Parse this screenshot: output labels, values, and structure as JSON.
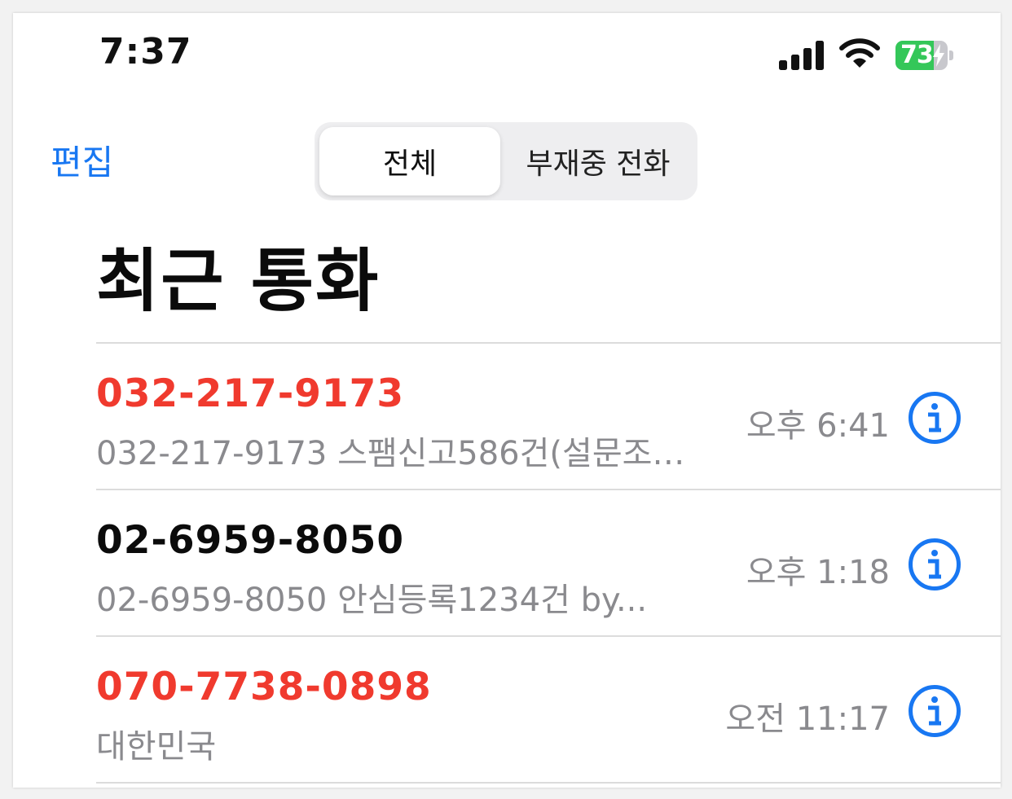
{
  "status_bar": {
    "time": "7:37",
    "battery_level": "73",
    "battery_fraction": 0.73
  },
  "nav": {
    "edit_label": "편집",
    "segments": [
      {
        "label": "전체",
        "selected": true
      },
      {
        "label": "부재중 전화",
        "selected": false
      }
    ]
  },
  "page_title": "최근 통화",
  "calls": [
    {
      "number": "032-217-9173",
      "detail": "032-217-9173 스팸신고586건(설문조…",
      "time": "오후 6:41",
      "missed": true
    },
    {
      "number": "02-6959-8050",
      "detail": "02-6959-8050 안심등록1234건 by...",
      "time": "오후 1:18",
      "missed": false
    },
    {
      "number": "070-7738-0898",
      "detail": "대한민국",
      "time": "오전 11:17",
      "missed": true
    }
  ],
  "colors": {
    "accent": "#1877f2",
    "missed": "#f03a2e",
    "normal": "#0b0b0b",
    "secondary": "#8a8a8e",
    "battery": "#34c759"
  },
  "icons": {
    "info": "info-circle-icon",
    "signal": "cellular-signal-icon",
    "wifi": "wifi-icon",
    "battery": "battery-charging-icon"
  }
}
